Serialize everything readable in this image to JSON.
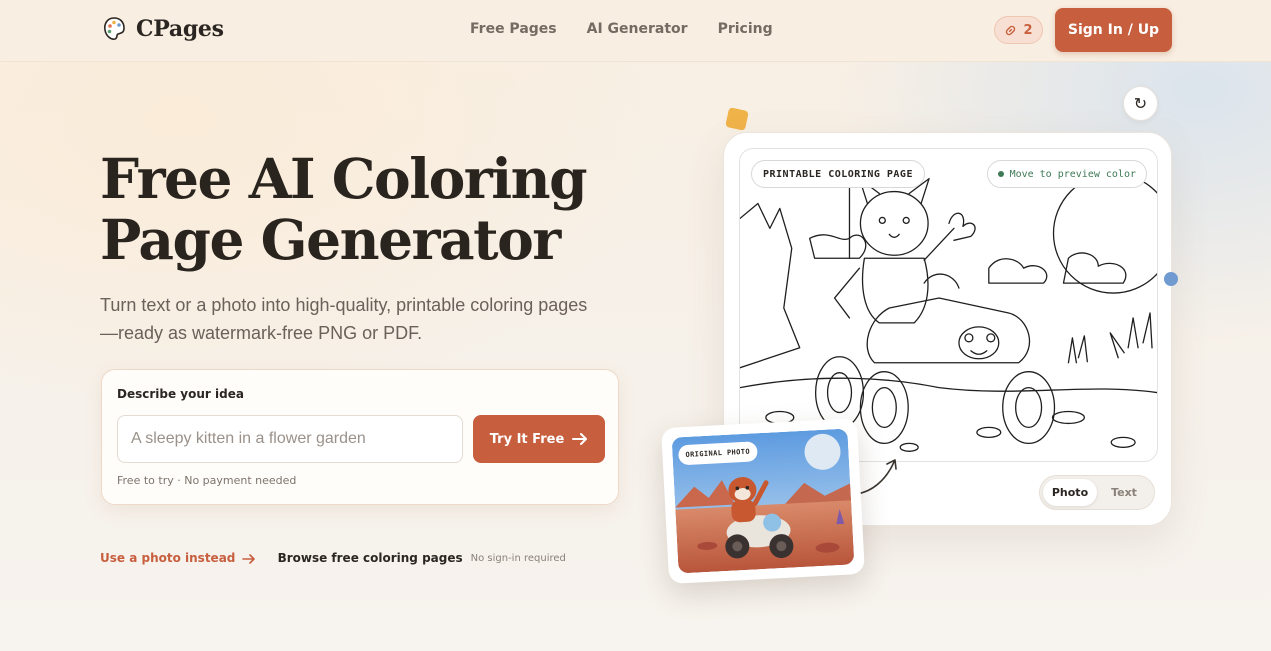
{
  "header": {
    "brand": "CPages",
    "nav": [
      "Free Pages",
      "AI Generator",
      "Pricing"
    ],
    "credits": "2",
    "signin_label": "Sign In / Up"
  },
  "hero": {
    "title_line1": "Free AI Coloring",
    "title_line2": "Page Generator",
    "subtitle_line1": "Turn text or a photo into high-quality, printable coloring pages",
    "subtitle_line2": "—ready as watermark-free PNG or PDF."
  },
  "idea": {
    "label": "Describe your idea",
    "placeholder": "A sleepy kitten in a flower garden",
    "value": "",
    "button_label": "Try It Free",
    "note": "Free to try · No payment needed"
  },
  "links": {
    "photo": "Use a photo instead",
    "browse": "Browse free coloring pages",
    "no_signin": "No sign-in required"
  },
  "preview": {
    "tag_printable": "PRINTABLE COLORING PAGE",
    "tag_move": "Move to preview color",
    "tag_original": "ORIGINAL PHOTO",
    "toggle": [
      "Photo",
      "Text"
    ],
    "toggle_active": "Photo"
  },
  "colors": {
    "accent": "#c75f3f",
    "background": "#f7f1e8",
    "heading": "#2a241f"
  },
  "icons": {
    "logo": "palette-icon",
    "credits": "link-icon",
    "refresh": "refresh-icon",
    "arrow": "arrow-right-icon"
  }
}
